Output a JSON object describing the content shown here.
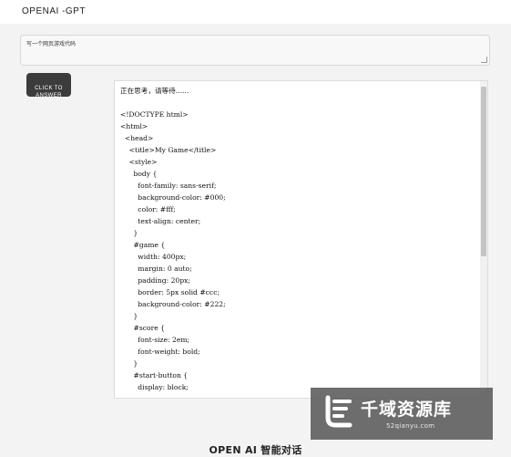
{
  "app": {
    "title": "OPENAI -GPT"
  },
  "prompt": {
    "value": "写一个网页游戏代码"
  },
  "answer_button": {
    "label": "CLICK TO\nANSWER"
  },
  "output": {
    "text": "正在思考，请等待......\n\n<!DOCTYPE html>\n<html>\n  <head>\n    <title>My Game</title>\n    <style>\n      body {\n        font-family: sans-serif;\n        background-color: #000;\n        color: #fff;\n        text-align: center;\n      }\n      #game {\n        width: 400px;\n        margin: 0 auto;\n        padding: 20px;\n        border: 5px solid #ccc;\n        background-color: #222;\n      }\n      #score {\n        font-size: 2em;\n        font-weight: bold;\n      }\n      #start-button {\n        display: block;"
  },
  "watermark": {
    "title": "千域资源库",
    "url": "52qianyu.com"
  },
  "footer": {
    "title": "OPEN AI 智能对话"
  },
  "colors": {
    "button_bg": "#3c3c3c",
    "page_bg": "#f3f3f3",
    "watermark_bg": "#5a5a5a"
  }
}
